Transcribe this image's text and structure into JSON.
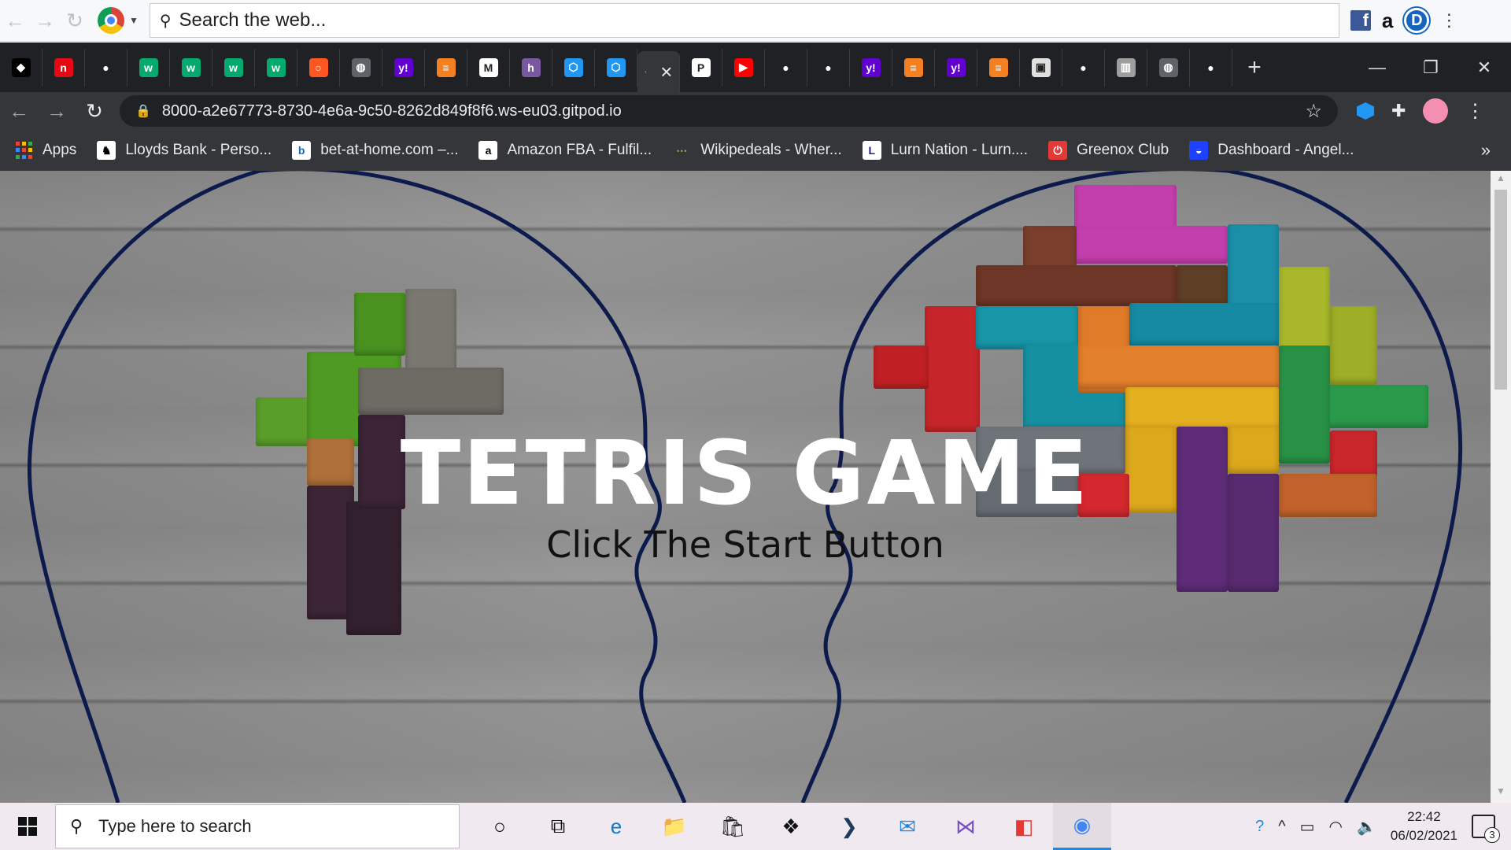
{
  "topbar": {
    "search_placeholder": "Search the web...",
    "extensions": [
      "facebook-icon",
      "amazon-icon",
      "profile-d-icon",
      "menu-dots-icon"
    ]
  },
  "tabs": {
    "count_visible": 30,
    "active_close": "×",
    "new_tab": "+",
    "window_controls": {
      "minimize": "—",
      "restore": "❐",
      "close": "✕"
    },
    "favicons": [
      {
        "name": "tab-streamlabs",
        "glyph": "◆",
        "color": "#000000"
      },
      {
        "name": "tab-netflix",
        "glyph": "n",
        "color": "#e50914"
      },
      {
        "name": "tab-github",
        "glyph": "●",
        "color": "#202124"
      },
      {
        "name": "tab-w3schools",
        "glyph": "w",
        "color": "#04aa6d"
      },
      {
        "name": "tab-w3schools",
        "glyph": "w",
        "color": "#04aa6d"
      },
      {
        "name": "tab-w3schools",
        "glyph": "w",
        "color": "#04aa6d"
      },
      {
        "name": "tab-w3schools",
        "glyph": "w",
        "color": "#04aa6d"
      },
      {
        "name": "tab-orange",
        "glyph": "○",
        "color": "#ff5722"
      },
      {
        "name": "tab-globe",
        "glyph": "◍",
        "color": "#5f6368"
      },
      {
        "name": "tab-yahoo",
        "glyph": "y!",
        "color": "#6001d2"
      },
      {
        "name": "tab-stackoverflow",
        "glyph": "≡",
        "color": "#f48024"
      },
      {
        "name": "tab-gmail",
        "glyph": "M",
        "color": "#ffffff"
      },
      {
        "name": "tab-heroku",
        "glyph": "h",
        "color": "#79589f"
      },
      {
        "name": "tab-gitpod",
        "glyph": "⬡",
        "color": "#2196f3"
      },
      {
        "name": "tab-gitpod",
        "glyph": "⬡",
        "color": "#2196f3"
      }
    ],
    "favicons_after_active": [
      {
        "name": "tab-pinterest",
        "glyph": "P",
        "color": "#ffffff"
      },
      {
        "name": "tab-youtube",
        "glyph": "▶",
        "color": "#ff0000"
      },
      {
        "name": "tab-github",
        "glyph": "●",
        "color": "#202124"
      },
      {
        "name": "tab-github",
        "glyph": "●",
        "color": "#202124"
      },
      {
        "name": "tab-yahoo",
        "glyph": "y!",
        "color": "#6001d2"
      },
      {
        "name": "tab-stackoverflow",
        "glyph": "≡",
        "color": "#f48024"
      },
      {
        "name": "tab-yahoo",
        "glyph": "y!",
        "color": "#6001d2"
      },
      {
        "name": "tab-stackoverflow",
        "glyph": "≡",
        "color": "#f48024"
      },
      {
        "name": "tab-doc",
        "glyph": "▣",
        "color": "#e0e0e0"
      },
      {
        "name": "tab-github",
        "glyph": "●",
        "color": "#202124"
      },
      {
        "name": "tab-reader",
        "glyph": "▥",
        "color": "#9e9e9e"
      },
      {
        "name": "tab-globe",
        "glyph": "◍",
        "color": "#5f6368"
      },
      {
        "name": "tab-github",
        "glyph": "●",
        "color": "#202124"
      }
    ]
  },
  "address": {
    "url": "8000-a2e67773-8730-4e6a-9c50-8262d849f8f6.ws-eu03.gitpod.io"
  },
  "bookmarks": [
    {
      "label": "Apps",
      "icon": "apps-grid-icon"
    },
    {
      "label": "Lloyds Bank - Perso...",
      "icon": "lloyds-icon",
      "color": "#ffffff",
      "fg": "#000000",
      "glyph": "♞"
    },
    {
      "label": "bet-at-home.com –...",
      "icon": "bet-at-home-icon",
      "color": "#ffffff",
      "fg": "#1565c0",
      "glyph": "b"
    },
    {
      "label": "Amazon FBA - Fulfil...",
      "icon": "amazon-icon",
      "color": "#ffffff",
      "fg": "#000000",
      "glyph": "a"
    },
    {
      "label": "Wikipedeals - Wher...",
      "icon": "wikipedeals-icon",
      "color": "#35363a",
      "fg": "#8bc34a",
      "glyph": "⋯"
    },
    {
      "label": "Lurn Nation - Lurn....",
      "icon": "lurn-icon",
      "color": "#ffffff",
      "fg": "#1a237e",
      "glyph": "L"
    },
    {
      "label": "Greenox Club",
      "icon": "greenox-icon",
      "color": "#e53935",
      "fg": "#ffffff",
      "glyph": "⏻"
    },
    {
      "label": "Dashboard - Angel...",
      "icon": "angel-icon",
      "color": "#1e40ff",
      "fg": "#ffffff",
      "glyph": "◒"
    }
  ],
  "bookmarks_more": "»",
  "page": {
    "title": "TETRIS GAME",
    "subtitle": "Click The Start Button"
  },
  "taskbar": {
    "search_placeholder": "Type here to search",
    "apps": [
      {
        "name": "cortana-icon",
        "glyph": "○"
      },
      {
        "name": "task-view-icon",
        "glyph": "⧉"
      },
      {
        "name": "edge-icon",
        "glyph": "e"
      },
      {
        "name": "file-explorer-icon",
        "glyph": "📁"
      },
      {
        "name": "store-icon",
        "glyph": "🛍"
      },
      {
        "name": "dropbox-icon",
        "glyph": "❖"
      },
      {
        "name": "powershell-icon",
        "glyph": "❯"
      },
      {
        "name": "mail-icon",
        "glyph": "✉"
      },
      {
        "name": "visual-studio-icon",
        "glyph": "⋈"
      },
      {
        "name": "office-icon",
        "glyph": "◧"
      },
      {
        "name": "chrome-icon",
        "glyph": "◉"
      }
    ],
    "time": "22:42",
    "date": "06/02/2021",
    "notification_count": "3"
  },
  "colors": {
    "brand_accent": "#1e88e5",
    "head_outline": "#0d1b4c"
  }
}
